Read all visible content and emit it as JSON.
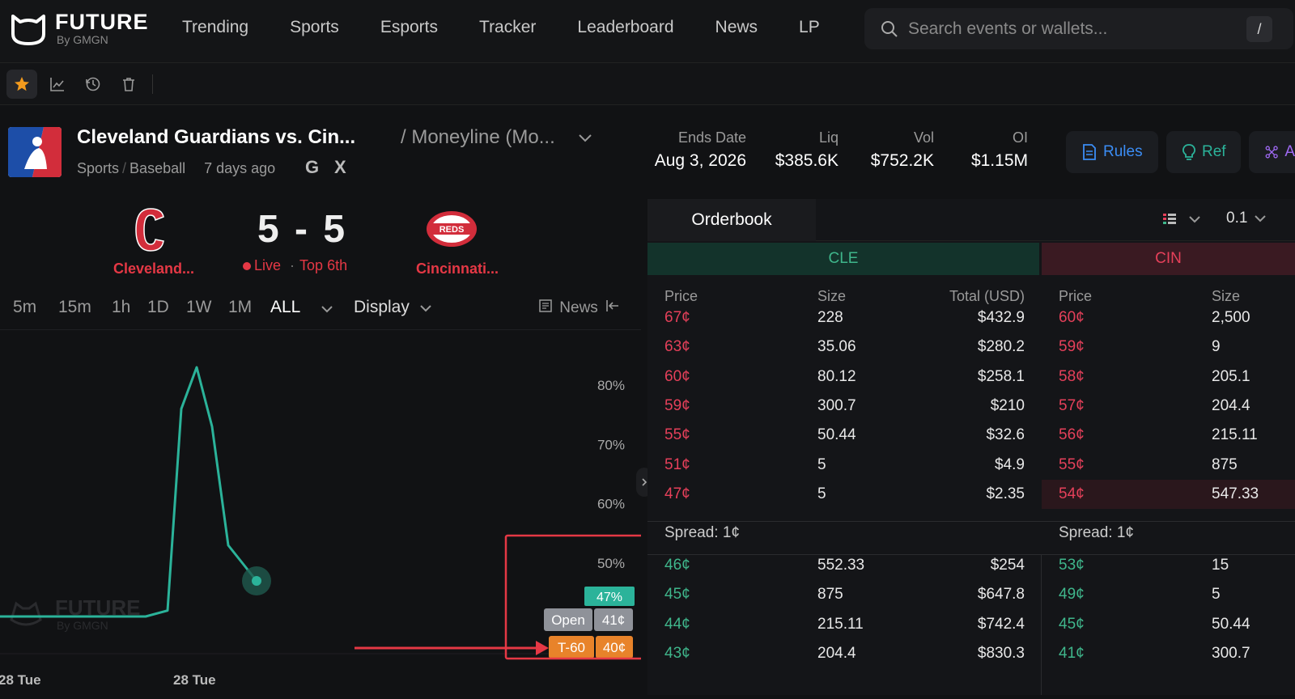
{
  "brand": {
    "name": "FUTURE",
    "sub": "By GMGN"
  },
  "nav": [
    "Trending",
    "Sports",
    "Esports",
    "Tracker",
    "Leaderboard",
    "News",
    "LP"
  ],
  "search": {
    "placeholder": "Search events or wallets...",
    "shortcut": "/"
  },
  "toolbar": {
    "icons": [
      "star-icon",
      "chart-icon",
      "history-icon",
      "trash-icon"
    ],
    "active": "star-icon"
  },
  "event": {
    "title": "Cleveland Guardians vs. Cin...",
    "market": "/ Moneyline (Mo...",
    "category": "Sports",
    "subcategory": "Baseball",
    "time_ago": "7 days ago",
    "google_icon": "G",
    "x_icon": "X"
  },
  "stats": {
    "ends_label": "Ends Date",
    "ends_value": "Aug 3, 2026",
    "liq_label": "Liq",
    "liq_value": "$385.6K",
    "vol_label": "Vol",
    "vol_value": "$752.2K",
    "oi_label": "OI",
    "oi_value": "$1.15M"
  },
  "header_buttons": {
    "rules": "Rules",
    "ref": "Ref",
    "more": "A"
  },
  "game": {
    "home": "Cleveland...",
    "away": "Cincinnati...",
    "score": "5 - 5",
    "status": "Live",
    "inning": "Top 6th",
    "away_logo_text": "REDS"
  },
  "timeframes": [
    "5m",
    "15m",
    "1h",
    "1D",
    "1W",
    "1M",
    "ALL"
  ],
  "timeframe_selected": "ALL",
  "display_label": "Display",
  "news_label": "News",
  "chart_data": {
    "type": "line",
    "yticks": [
      "80%",
      "70%",
      "60%",
      "50%"
    ],
    "xticks": [
      "28 Tue",
      "28 Tue"
    ],
    "values": [
      41,
      41,
      41,
      41,
      41,
      42,
      76,
      83,
      73,
      53,
      47
    ],
    "current_label": "47%",
    "open_label": "Open",
    "open_value": "41¢",
    "t60_label": "T-60",
    "t60_value": "40¢",
    "watermark": "FUTURE",
    "watermark_sub": "By GMGN"
  },
  "orderbook": {
    "tab": "Orderbook",
    "tick": "0.1",
    "left_side": "CLE",
    "right_side": "CIN",
    "headers": {
      "price": "Price",
      "size": "Size",
      "total": "Total (USD)"
    },
    "cle_asks": [
      {
        "p": "67¢",
        "s": "228",
        "t": "$432.9"
      },
      {
        "p": "63¢",
        "s": "35.06",
        "t": "$280.2"
      },
      {
        "p": "60¢",
        "s": "80.12",
        "t": "$258.1"
      },
      {
        "p": "59¢",
        "s": "300.7",
        "t": "$210"
      },
      {
        "p": "55¢",
        "s": "50.44",
        "t": "$32.6"
      },
      {
        "p": "51¢",
        "s": "5",
        "t": "$4.9"
      },
      {
        "p": "47¢",
        "s": "5",
        "t": "$2.35"
      }
    ],
    "cle_spread": "Spread: 1¢",
    "cle_bids": [
      {
        "p": "46¢",
        "s": "552.33",
        "t": "$254"
      },
      {
        "p": "45¢",
        "s": "875",
        "t": "$647.8"
      },
      {
        "p": "44¢",
        "s": "215.11",
        "t": "$742.4"
      },
      {
        "p": "43¢",
        "s": "204.4",
        "t": "$830.3"
      }
    ],
    "cin_asks": [
      {
        "p": "60¢",
        "s": "2,500"
      },
      {
        "p": "59¢",
        "s": "9"
      },
      {
        "p": "58¢",
        "s": "205.1"
      },
      {
        "p": "57¢",
        "s": "204.4"
      },
      {
        "p": "56¢",
        "s": "215.11"
      },
      {
        "p": "55¢",
        "s": "875"
      },
      {
        "p": "54¢",
        "s": "547.33"
      }
    ],
    "cin_spread": "Spread: 1¢",
    "cin_bids": [
      {
        "p": "53¢",
        "s": "15"
      },
      {
        "p": "49¢",
        "s": "5"
      },
      {
        "p": "45¢",
        "s": "50.44"
      },
      {
        "p": "41¢",
        "s": "300.7"
      }
    ]
  },
  "colors": {
    "accent": "#2bb39a",
    "ask": "#e5405a",
    "bid": "#3fb68b",
    "orange": "#e8832a",
    "annotation": "#e53845"
  }
}
